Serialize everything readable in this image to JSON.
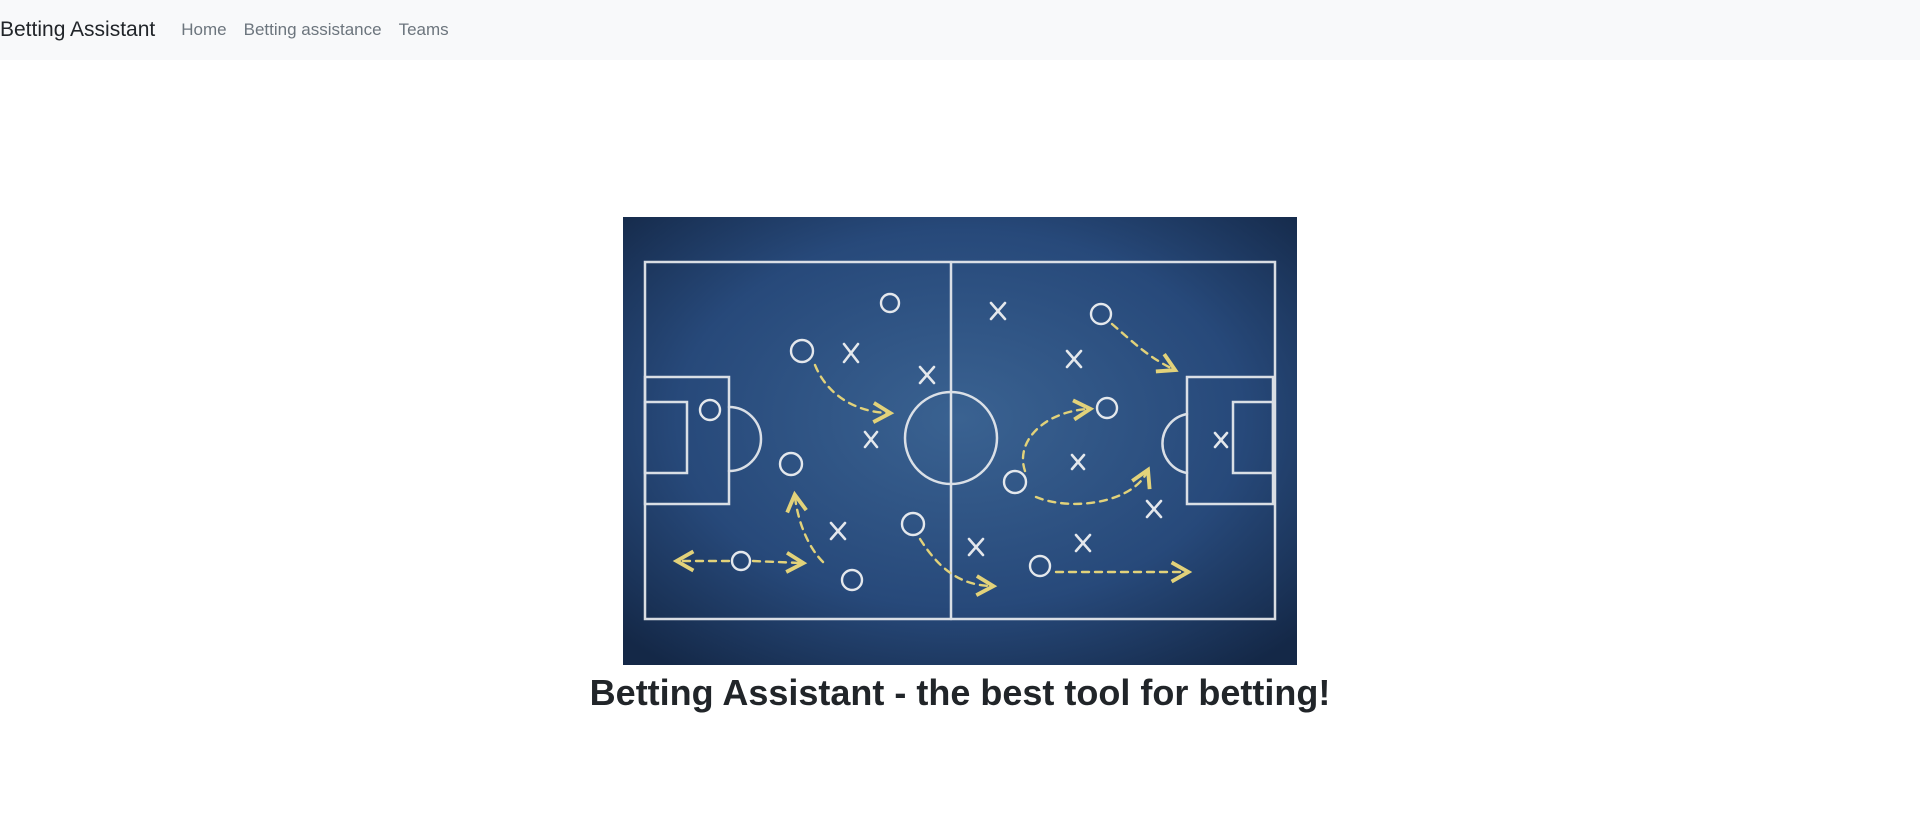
{
  "navbar": {
    "brand": "Betting Assistant",
    "links": [
      "Home",
      "Betting assistance",
      "Teams"
    ]
  },
  "hero": {
    "image_icon": "football-tactics-board-icon",
    "title": "Betting Assistant - the best tool for betting!"
  },
  "colors": {
    "navbar_bg": "#f8f9fa",
    "board_dark": "#16294a",
    "board_mid": "#2f5584",
    "chalk": "#eef0f2",
    "chalk_yellow": "#e2d27a"
  }
}
